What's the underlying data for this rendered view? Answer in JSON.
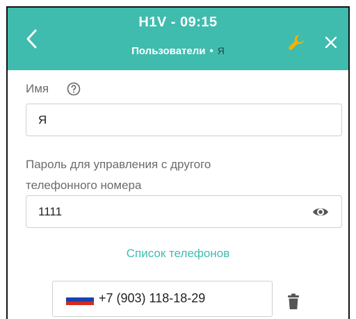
{
  "header": {
    "title": "H1V - 09:15",
    "breadcrumb_section": "Пользователи",
    "breadcrumb_sep": "•",
    "breadcrumb_current": "Я",
    "bg_color": "#3fbcae",
    "wrench_color": "#f5b100"
  },
  "form": {
    "name_label": "Имя",
    "name_value": "Я",
    "password_label_line1": "Пароль для управления с другого",
    "password_label_line2": "телефонного номера",
    "password_value": "1111",
    "phones_link": "Список телефонов",
    "phone_value": "+7 (903) 118-18-29"
  },
  "icons": {
    "back": "chevron-left-icon",
    "settings": "wrench-icon",
    "close": "close-icon",
    "help": "help-circle-icon",
    "visibility": "eye-icon",
    "flag": "russia-flag-icon",
    "delete": "trash-icon"
  }
}
